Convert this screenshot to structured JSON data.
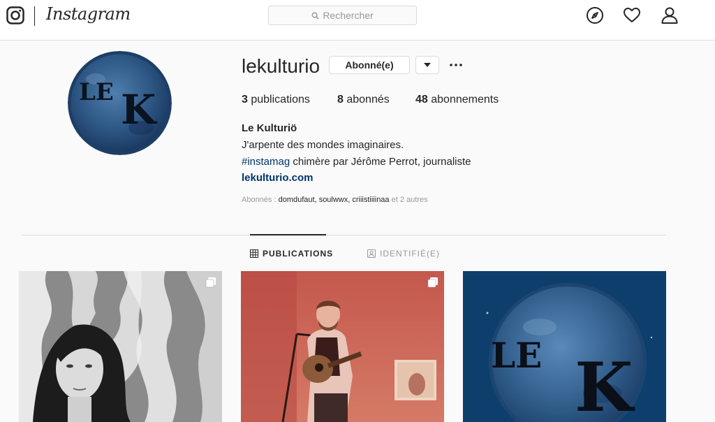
{
  "topbar": {
    "brand": "Instagram",
    "search_placeholder": "Rechercher",
    "icons": [
      "instagram-logo-icon",
      "search-icon",
      "explore-compass-icon",
      "heart-icon",
      "profile-user-icon"
    ]
  },
  "profile": {
    "username": "lekulturio",
    "follow_label": "Abonné(e)",
    "avatar_text": "LE K",
    "stats": {
      "posts_count": "3",
      "posts_label": "publications",
      "followers_count": "8",
      "followers_label": "abonnés",
      "following_count": "48",
      "following_label": "abonnements"
    },
    "bio": {
      "name": "Le Kulturiö",
      "line1": "J'arpente des mondes imaginaires.",
      "hashtag": "#instamag",
      "line2_rest": " chimère par Jérôme Perrot, journaliste",
      "link": "lekulturio.com"
    },
    "followed_by": {
      "prefix": "Abonnés : ",
      "names": "domdufaut, soulwwx, criiistiiiinaa",
      "suffix": " et 2 autres"
    }
  },
  "tabs": [
    {
      "label": "PUBLICATIONS",
      "active": true
    },
    {
      "label": "IDENTIFIÉ(E)",
      "active": false
    }
  ],
  "posts": [
    {
      "kind": "portrait",
      "multi": true
    },
    {
      "kind": "concert",
      "multi": true
    },
    {
      "kind": "logo",
      "text": "LE K",
      "multi": false
    }
  ],
  "colors": {
    "link": "#003569",
    "border": "#dbdbdb",
    "background": "#fafafa",
    "muted": "#999999"
  }
}
